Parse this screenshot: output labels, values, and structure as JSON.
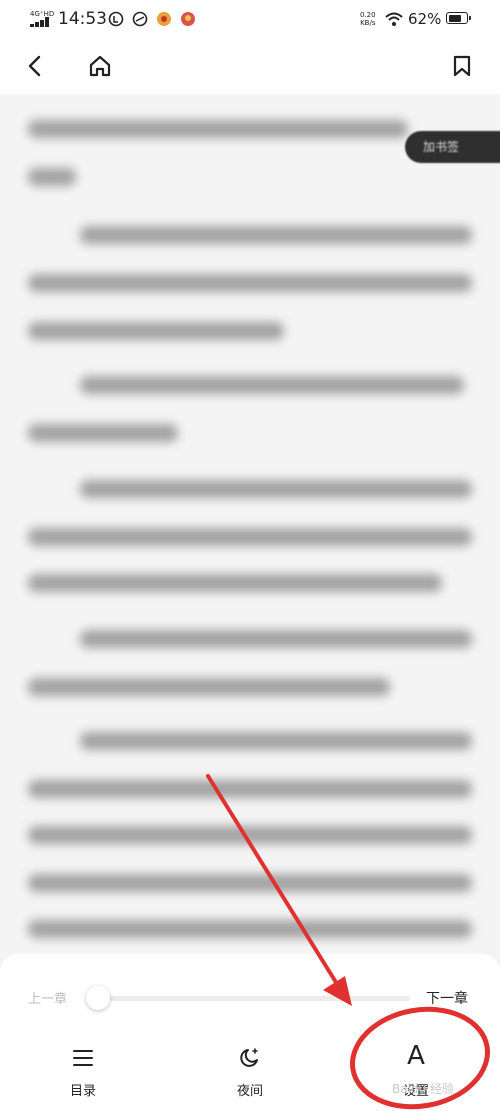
{
  "status_bar": {
    "network": "4G⁺HD",
    "time": "14:53",
    "speed_value": "0.20",
    "speed_unit": "KB/s",
    "battery_percent": "62%"
  },
  "nav": {
    "back_icon": "chevron-left-icon",
    "home_icon": "home-icon",
    "bookmark_icon": "bookmark-icon"
  },
  "reader": {
    "bookmark_pill": "加书签"
  },
  "bottom_panel": {
    "prev_chapter": "上一章",
    "next_chapter": "下一章",
    "progress": 0.0,
    "tabs": [
      {
        "label": "目录",
        "icon": "list-icon"
      },
      {
        "label": "夜间",
        "icon": "moon-icon"
      },
      {
        "label": "设置",
        "icon": "font-a-icon",
        "glyph": "A"
      }
    ]
  },
  "annotation": {
    "arrow_color": "#e03030",
    "circle_color": "#e03030"
  }
}
